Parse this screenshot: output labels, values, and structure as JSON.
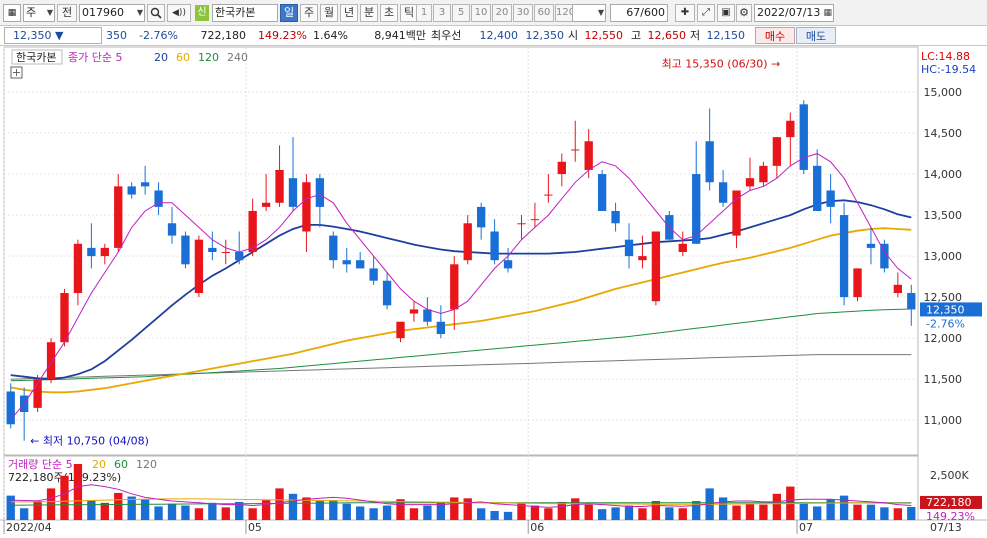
{
  "toolbar": {
    "market": "주",
    "prev_label": "전",
    "code": "017960",
    "sound_label": "◀))",
    "credit_badge": "신",
    "stock_name": "한국카본",
    "period_tabs": [
      "일",
      "주",
      "월",
      "년",
      "분",
      "초",
      "틱"
    ],
    "active_period": "일",
    "intervals": [
      "1",
      "3",
      "5",
      "10",
      "20",
      "30",
      "60",
      "120"
    ],
    "count": "67",
    "count_total": "/600",
    "date": "2022/07/13"
  },
  "quote": {
    "price": "12,350",
    "direction": "▼",
    "change": "350",
    "change_pct": "-2.76%",
    "volume": "722,180",
    "volume_ratio": "149.23%",
    "turnover": "1.64%",
    "amount": "8,941백만",
    "best_ask_label": "최우선",
    "best_ask": "12,400",
    "best_bid": "12,350",
    "open_label": "시",
    "open": "12,550",
    "high_label": "고",
    "high": "12,650",
    "low_label": "저",
    "low": "12,150",
    "buy_label": "매수",
    "sell_label": "매도"
  },
  "chart_data": {
    "type": "candlestick",
    "legend": {
      "name": "한국카본",
      "ma_label": "종가 단순",
      "periods": [
        "5",
        "20",
        "60",
        "120",
        "240"
      ],
      "colors": {
        "5": "#c020c0",
        "20": "#1f3f9f",
        "60": "#e8a800",
        "120": "#1e8e3e",
        "240": "#777777"
      }
    },
    "colors": {
      "up": "#e8161b",
      "down": "#1a6fd6",
      "annotation_high": "#d01010",
      "annotation_low": "#1010c0",
      "lc": "#e00000",
      "hc": "#1a3fbf"
    },
    "y_range": [
      10600,
      15500
    ],
    "y_ticks": [
      11000,
      11500,
      12000,
      12500,
      13000,
      13500,
      14000,
      14500,
      15000
    ],
    "y_tick_labels": [
      "11,000",
      "11,500",
      "12,000",
      "12,500",
      "13,000",
      "13,500",
      "14,000",
      "14,500",
      "15,000"
    ],
    "x_labels": [
      {
        "index": 0,
        "label": "2022/04"
      },
      {
        "index": 18,
        "label": "05"
      },
      {
        "index": 39,
        "label": "06"
      },
      {
        "index": 59,
        "label": "07"
      }
    ],
    "x_end_label": "07/13",
    "lc_label": "LC:14.88",
    "hc_label": "HC:-19.54",
    "high_annotation": {
      "index": 58,
      "value": 15350,
      "text": "최고 15,350 (06/30)"
    },
    "low_annotation": {
      "index": 1,
      "value": 10750,
      "text": "최저 10,750 (04/08)"
    },
    "last_price_label": "12,350",
    "last_pct_label": "-2.76%",
    "candles": [
      [
        11350,
        11450,
        10900,
        10950
      ],
      [
        11300,
        11400,
        10750,
        11100
      ],
      [
        11150,
        11550,
        11100,
        11500
      ],
      [
        11500,
        12000,
        11450,
        11950
      ],
      [
        11950,
        12600,
        11900,
        12550
      ],
      [
        12550,
        13200,
        12400,
        13150
      ],
      [
        13100,
        13400,
        12850,
        13000
      ],
      [
        13000,
        13150,
        12900,
        13100
      ],
      [
        13100,
        14000,
        13050,
        13850
      ],
      [
        13850,
        13900,
        13700,
        13750
      ],
      [
        13900,
        14100,
        13750,
        13850
      ],
      [
        13800,
        13900,
        13500,
        13600
      ],
      [
        13400,
        13600,
        13150,
        13250
      ],
      [
        13250,
        13300,
        12850,
        12900
      ],
      [
        12550,
        13250,
        12500,
        13200
      ],
      [
        13100,
        13300,
        12950,
        13050
      ],
      [
        13050,
        13200,
        12900,
        13050
      ],
      [
        13050,
        13300,
        12900,
        12950
      ],
      [
        13050,
        13700,
        13000,
        13550
      ],
      [
        13600,
        14000,
        13550,
        13650
      ],
      [
        13650,
        14350,
        13600,
        14050
      ],
      [
        13950,
        14450,
        13550,
        13600
      ],
      [
        13300,
        14000,
        13050,
        13900
      ],
      [
        13950,
        14000,
        13350,
        13600
      ],
      [
        13250,
        13300,
        12850,
        12950
      ],
      [
        12950,
        13100,
        12800,
        12900
      ],
      [
        12950,
        13050,
        12850,
        12850
      ],
      [
        12850,
        13000,
        12650,
        12700
      ],
      [
        12700,
        12800,
        12350,
        12400
      ],
      [
        12000,
        12200,
        11950,
        12200
      ],
      [
        12300,
        12450,
        12200,
        12350
      ],
      [
        12350,
        12500,
        12150,
        12200
      ],
      [
        12200,
        12400,
        12000,
        12050
      ],
      [
        12350,
        13000,
        12100,
        12900
      ],
      [
        12950,
        13500,
        12900,
        13400
      ],
      [
        13600,
        13650,
        13200,
        13350
      ],
      [
        13300,
        13450,
        12900,
        12950
      ],
      [
        12950,
        13100,
        12800,
        12850
      ],
      [
        13400,
        13500,
        13200,
        13400
      ],
      [
        13450,
        13650,
        13350,
        13450
      ],
      [
        13750,
        14000,
        13650,
        13750
      ],
      [
        14000,
        14250,
        13850,
        14150
      ],
      [
        14300,
        14650,
        14150,
        14300
      ],
      [
        14050,
        14550,
        13950,
        14400
      ],
      [
        14000,
        14050,
        13550,
        13550
      ],
      [
        13550,
        13650,
        13300,
        13400
      ],
      [
        13200,
        13400,
        12850,
        13000
      ],
      [
        12950,
        13250,
        12850,
        13000
      ],
      [
        12450,
        13250,
        12400,
        13300
      ],
      [
        13500,
        13550,
        13200,
        13200
      ],
      [
        13050,
        13300,
        13000,
        13150
      ],
      [
        14000,
        14400,
        13150,
        13150
      ],
      [
        14400,
        14800,
        13800,
        13900
      ],
      [
        13900,
        14050,
        13600,
        13650
      ],
      [
        13250,
        13750,
        13100,
        13800
      ],
      [
        13850,
        14200,
        13800,
        13950
      ],
      [
        13900,
        14150,
        13850,
        14100
      ],
      [
        14100,
        14450,
        13950,
        14450
      ],
      [
        14450,
        14750,
        14100,
        14650
      ],
      [
        14850,
        14900,
        14000,
        14050
      ],
      [
        14100,
        14300,
        13550,
        13550
      ],
      [
        13800,
        14000,
        13400,
        13600
      ],
      [
        13500,
        13650,
        12400,
        12500
      ],
      [
        12500,
        12850,
        12450,
        12850
      ],
      [
        13150,
        13350,
        12900,
        13100
      ],
      [
        13150,
        13200,
        12800,
        12850
      ],
      [
        12550,
        12800,
        12500,
        12650
      ],
      [
        12550,
        12650,
        12150,
        12350
      ]
    ],
    "ma": {
      "5": [
        11010,
        11200,
        11450,
        11700,
        11950,
        12250,
        12550,
        12800,
        13050,
        13350,
        13550,
        13650,
        13650,
        13500,
        13350,
        13200,
        13100,
        13050,
        13100,
        13200,
        13350,
        13550,
        13700,
        13750,
        13650,
        13400,
        13200,
        13000,
        12800,
        12600,
        12450,
        12350,
        12300,
        12350,
        12450,
        12650,
        12850,
        13000,
        13200,
        13350,
        13500,
        13700,
        13900,
        14050,
        14150,
        14100,
        13950,
        13750,
        13550,
        13350,
        13200,
        13250,
        13400,
        13550,
        13700,
        13800,
        13850,
        13950,
        14100,
        14200,
        14250,
        14150,
        13950,
        13650,
        13350,
        13050,
        12850,
        12720
      ],
      "20": [
        11550,
        11530,
        11510,
        11500,
        11520,
        11560,
        11620,
        11720,
        11850,
        11980,
        12120,
        12260,
        12400,
        12530,
        12650,
        12760,
        12850,
        12950,
        13050,
        13150,
        13250,
        13330,
        13380,
        13380,
        13360,
        13330,
        13300,
        13260,
        13220,
        13180,
        13140,
        13110,
        13080,
        13060,
        13050,
        13040,
        13030,
        13030,
        13030,
        13030,
        13030,
        13040,
        13050,
        13070,
        13090,
        13110,
        13130,
        13150,
        13170,
        13180,
        13190,
        13200,
        13220,
        13260,
        13300,
        13350,
        13400,
        13450,
        13500,
        13570,
        13630,
        13670,
        13680,
        13660,
        13620,
        13570,
        13510,
        13470
      ],
      "60": [
        11400,
        11370,
        11350,
        11340,
        11340,
        11350,
        11370,
        11390,
        11420,
        11450,
        11480,
        11510,
        11540,
        11570,
        11600,
        11630,
        11660,
        11690,
        11720,
        11750,
        11780,
        11810,
        11850,
        11890,
        11930,
        11970,
        12000,
        12030,
        12060,
        12090,
        12110,
        12130,
        12150,
        12170,
        12190,
        12210,
        12240,
        12270,
        12300,
        12330,
        12370,
        12410,
        12450,
        12500,
        12550,
        12600,
        12640,
        12680,
        12720,
        12760,
        12800,
        12840,
        12880,
        12920,
        12950,
        12980,
        13020,
        13060,
        13100,
        13150,
        13200,
        13250,
        13280,
        13310,
        13330,
        13340,
        13330,
        13320
      ],
      "120": [
        11480,
        11485,
        11490,
        11495,
        11500,
        11505,
        11510,
        11515,
        11520,
        11525,
        11530,
        11540,
        11550,
        11560,
        11570,
        11580,
        11590,
        11600,
        11610,
        11620,
        11630,
        11645,
        11660,
        11675,
        11690,
        11705,
        11720,
        11735,
        11750,
        11765,
        11780,
        11795,
        11810,
        11825,
        11840,
        11855,
        11870,
        11885,
        11900,
        11915,
        11930,
        11945,
        11960,
        11975,
        11990,
        12005,
        12020,
        12040,
        12060,
        12080,
        12100,
        12120,
        12140,
        12160,
        12180,
        12200,
        12220,
        12240,
        12260,
        12280,
        12300,
        12310,
        12320,
        12330,
        12340,
        12345,
        12350,
        12355
      ],
      "240": [
        11500,
        11505,
        11510,
        11515,
        11520,
        11525,
        11530,
        11535,
        11540,
        11545,
        11550,
        11555,
        11560,
        11565,
        11570,
        11575,
        11580,
        11585,
        11590,
        11595,
        11600,
        11605,
        11610,
        11615,
        11620,
        11625,
        11630,
        11635,
        11640,
        11645,
        11650,
        11655,
        11660,
        11665,
        11670,
        11675,
        11680,
        11685,
        11690,
        11695,
        11700,
        11705,
        11710,
        11715,
        11720,
        11725,
        11730,
        11735,
        11740,
        11745,
        11750,
        11755,
        11760,
        11765,
        11770,
        11775,
        11780,
        11785,
        11790,
        11795,
        11800,
        11800,
        11800,
        11800,
        11800,
        11800,
        11800,
        11800
      ]
    },
    "volume": {
      "legend_name": "거래량",
      "ma_label": "단순",
      "periods": [
        "5",
        "20",
        "60",
        "120"
      ],
      "period_colors": {
        "5": "#c020c0",
        "20": "#e8a800",
        "60": "#1e8e3e",
        "120": "#777777"
      },
      "info_label": "722,180주(149.23%)",
      "y_tick_labels": [
        "2,500K",
        "722,180",
        "149.23%"
      ],
      "y_range": [
        0,
        3100000
      ],
      "values": [
        1350000,
        650000,
        1050000,
        1750000,
        2450000,
        3100000,
        1100000,
        950000,
        1500000,
        1300000,
        1150000,
        750000,
        900000,
        800000,
        650000,
        950000,
        700000,
        1000000,
        650000,
        1100000,
        1750000,
        1450000,
        1250000,
        1050000,
        1100000,
        900000,
        750000,
        650000,
        800000,
        1150000,
        650000,
        800000,
        1000000,
        1250000,
        1200000,
        650000,
        500000,
        450000,
        950000,
        800000,
        650000,
        1000000,
        1200000,
        850000,
        600000,
        700000,
        800000,
        650000,
        1050000,
        700000,
        650000,
        1050000,
        1750000,
        1250000,
        800000,
        900000,
        850000,
        1450000,
        1850000,
        950000,
        750000,
        1150000,
        1350000,
        850000,
        850000,
        700000,
        650000,
        722180
      ],
      "ma5": [
        1100000,
        1080000,
        1060000,
        1200000,
        1450000,
        1850000,
        1950000,
        1850000,
        1700000,
        1450000,
        1250000,
        1150000,
        1050000,
        1000000,
        950000,
        900000,
        850000,
        850000,
        800000,
        850000,
        950000,
        1050000,
        1150000,
        1200000,
        1250000,
        1200000,
        1100000,
        1000000,
        900000,
        850000,
        850000,
        850000,
        850000,
        900000,
        950000,
        1000000,
        900000,
        850000,
        800000,
        750000,
        700000,
        750000,
        850000,
        900000,
        850000,
        800000,
        750000,
        750000,
        800000,
        780000,
        760000,
        800000,
        900000,
        1000000,
        1050000,
        1050000,
        1000000,
        1000000,
        1100000,
        1150000,
        1150000,
        1150000,
        1100000,
        1050000,
        1000000,
        950000,
        850000,
        800000
      ],
      "ma20": [
        1000000,
        1000000,
        1010000,
        1020000,
        1040000,
        1060000,
        1080000,
        1100000,
        1120000,
        1140000,
        1150000,
        1160000,
        1170000,
        1170000,
        1170000,
        1160000,
        1150000,
        1140000,
        1130000,
        1120000,
        1110000,
        1100000,
        1090000,
        1080000,
        1070000,
        1060000,
        1050000,
        1040000,
        1030000,
        1020000,
        1010000,
        1000000,
        990000,
        980000,
        970000,
        960000,
        950000,
        940000,
        930000,
        920000,
        910000,
        900000,
        900000,
        900000,
        895000,
        890000,
        885000,
        880000,
        875000,
        870000,
        870000,
        870000,
        875000,
        880000,
        885000,
        890000,
        895000,
        900000,
        910000,
        920000,
        930000,
        935000,
        940000,
        940000,
        935000,
        930000,
        925000,
        920000
      ],
      "ma60": [
        820000,
        825000,
        830000,
        835000,
        840000,
        845000,
        850000,
        855000,
        860000,
        865000,
        870000,
        875000,
        880000,
        885000,
        890000,
        895000,
        900000,
        905000,
        910000,
        915000,
        920000,
        925000,
        930000,
        935000,
        940000,
        945000,
        950000,
        955000,
        960000,
        960000,
        960000,
        960000,
        960000,
        960000,
        960000,
        960000,
        960000,
        960000,
        960000,
        960000,
        960000,
        960000,
        960000,
        960000,
        960000,
        960000,
        960000,
        960000,
        960000,
        960000,
        960000,
        960000,
        960000,
        960000,
        960000,
        960000,
        960000,
        960000,
        960000,
        960000,
        960000,
        960000,
        960000,
        960000,
        960000,
        960000,
        960000,
        960000
      ]
    }
  }
}
